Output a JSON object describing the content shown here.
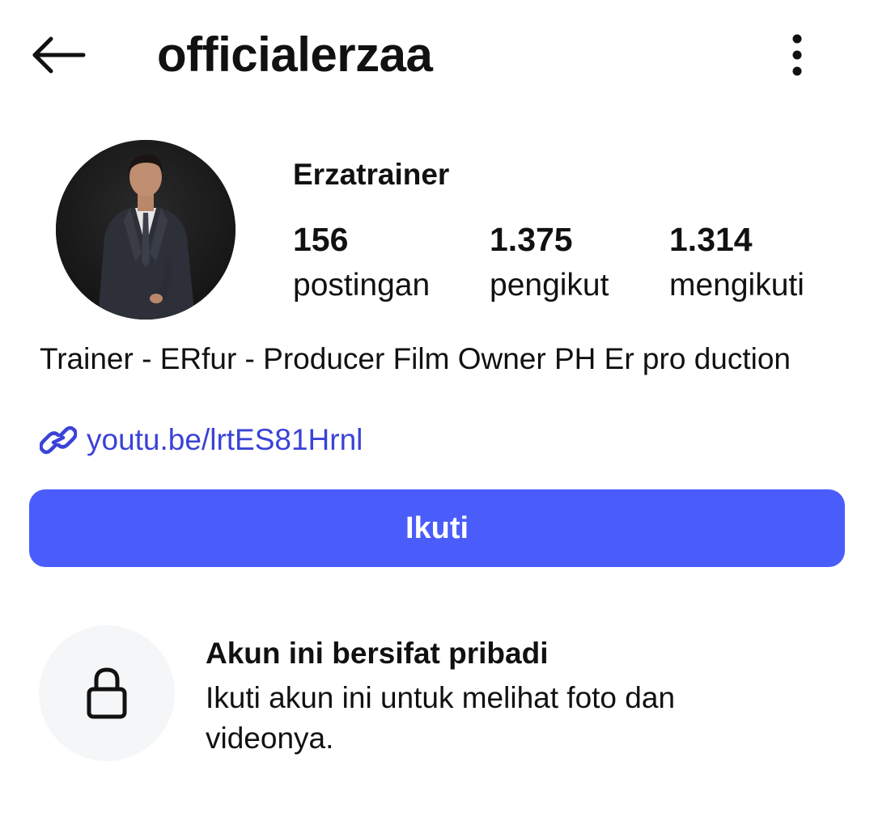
{
  "header": {
    "username": "officialerzaa",
    "back_icon": "arrow-left-icon",
    "more_icon": "more-vertical-icon"
  },
  "profile": {
    "display_name": "Erzatrainer",
    "avatar_icon": "profile-photo",
    "stats": [
      {
        "value": "156",
        "label": "postingan"
      },
      {
        "value": "1.375",
        "label": "pengikut"
      },
      {
        "value": "1.314",
        "label": "mengikuti"
      }
    ],
    "bio": "Trainer - ERfur - Producer Film Owner PH Er pro duction",
    "link": {
      "icon": "link-icon",
      "text": "youtu.be/lrtES81Hrnl"
    }
  },
  "actions": {
    "follow_label": "Ikuti"
  },
  "private_notice": {
    "icon": "lock-icon",
    "title": "Akun ini bersifat pribadi",
    "description": "Ikuti akun ini untuk melihat foto dan videonya."
  },
  "colors": {
    "accent": "#4a5dfb",
    "link": "#3a43d6",
    "text": "#111111",
    "lock_bg": "#f5f6f7"
  }
}
